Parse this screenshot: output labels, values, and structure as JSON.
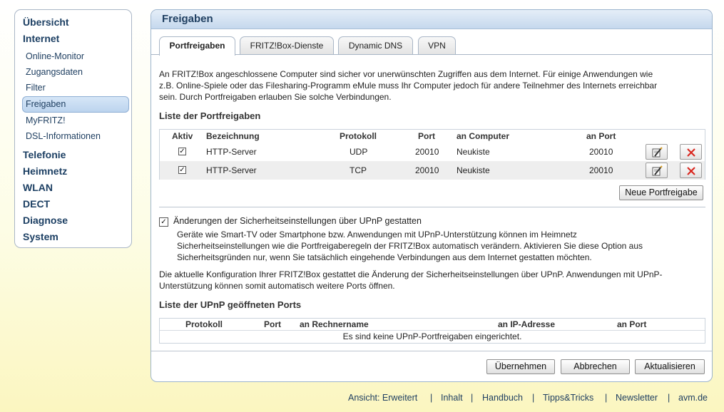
{
  "sidebar": {
    "top_items": [
      "Übersicht",
      "Internet"
    ],
    "sub_items": [
      "Online-Monitor",
      "Zugangsdaten",
      "Filter",
      "Freigaben",
      "MyFRITZ!",
      "DSL-Informationen"
    ],
    "bottom_items": [
      "Telefonie",
      "Heimnetz",
      "WLAN",
      "DECT",
      "Diagnose",
      "System"
    ],
    "active": "Freigaben"
  },
  "panel": {
    "title": "Freigaben",
    "tabs": [
      "Portfreigaben",
      "FRITZ!Box-Dienste",
      "Dynamic DNS",
      "VPN"
    ],
    "intro": [
      "An FRITZ!Box angeschlossene Computer sind sicher vor unerwünschten Zugriffen aus dem Internet. Für einige Anwendungen wie",
      "z.B. Online-Spiele oder das Filesharing-Programm eMule muss Ihr Computer jedoch für andere Teilnehmer des Internets erreichbar",
      "sein. Durch Portfreigaben erlauben Sie solche Verbindungen."
    ],
    "list_heading": "Liste der Portfreigaben",
    "columns": [
      "Aktiv",
      "Bezeichnung",
      "Protokoll",
      "Port",
      "an Computer",
      "an Port"
    ],
    "rows": [
      {
        "active": true,
        "name": "HTTP-Server",
        "protocol": "UDP",
        "port": "20010",
        "computer": "Neukiste",
        "to_port": "20010"
      },
      {
        "active": true,
        "name": "HTTP-Server",
        "protocol": "TCP",
        "port": "20010",
        "computer": "Neukiste",
        "to_port": "20010"
      }
    ],
    "new_button": "Neue Portfreigabe",
    "upnp_label": "Änderungen der Sicherheitseinstellungen über UPnP gestatten",
    "upnp_checked": true,
    "upnp_desc": [
      "Geräte wie Smart-TV oder Smartphone bzw. Anwendungen mit UPnP-Unterstützung können im Heimnetz",
      "Sicherheitseinstellungen wie die Portfreigaberegeln der FRITZ!Box automatisch verändern. Aktivieren Sie diese Option aus",
      "Sicherheitsgründen nur, wenn Sie tatsächlich eingehende Verbindungen aus dem Internet gestatten möchten."
    ],
    "config_note": [
      "Die aktuelle Konfiguration Ihrer FRITZ!Box gestattet die Änderung der Sicherheitseinstellungen über UPnP. Anwendungen mit UPnP-",
      "Unterstützung können somit automatisch weitere Ports öffnen."
    ],
    "upnp_heading": "Liste der UPnP geöffneten Ports",
    "upnp_columns": [
      "Protokoll",
      "Port",
      "an Rechnername",
      "an IP-Adresse",
      "an Port"
    ],
    "upnp_empty": "Es sind keine UPnP-Portfreigaben eingerichtet.",
    "buttons": {
      "apply": "Übernehmen",
      "cancel": "Abbrechen",
      "refresh": "Aktualisieren"
    }
  },
  "footer": {
    "links": [
      "Ansicht: Erweitert",
      "Inhalt",
      "Handbuch",
      "Tipps&Tricks",
      "Newsletter",
      "avm.de"
    ],
    "separator": "|"
  },
  "colors": {
    "accent": "#1f3f61",
    "delete": "#d9241c"
  }
}
